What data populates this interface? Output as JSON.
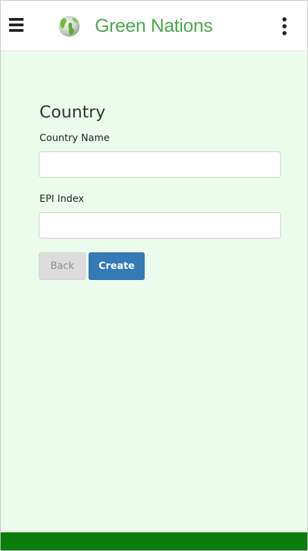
{
  "app": {
    "title": "Green Nations",
    "brand_color": "#4aa84a",
    "icons": {
      "menu": "hamburger-menu-icon",
      "logo": "globe-icon",
      "more": "vertical-ellipsis-icon"
    }
  },
  "form": {
    "heading": "Country",
    "fields": [
      {
        "label": "Country Name",
        "value": "",
        "placeholder": ""
      },
      {
        "label": "EPI Index",
        "value": "",
        "placeholder": ""
      }
    ],
    "back_label": "Back",
    "create_label": "Create"
  },
  "colors": {
    "content_background": "#ecfcec",
    "footer": "#0a7d0a",
    "primary_button": "#337ab7",
    "secondary_button": "#dcdcdc"
  }
}
